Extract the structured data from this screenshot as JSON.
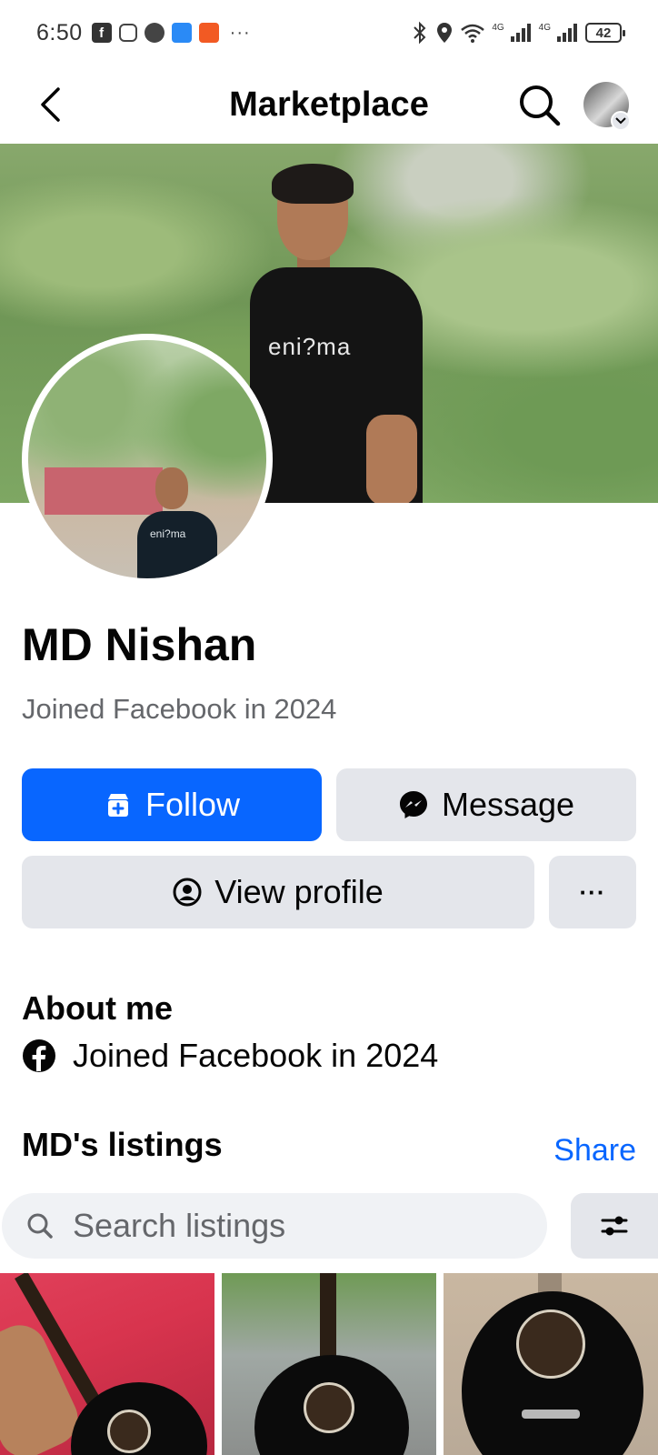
{
  "status_bar": {
    "time": "6:50",
    "more": "···",
    "network_1": "4G",
    "network_2": "4G",
    "battery": "42"
  },
  "header": {
    "title": "Marketplace"
  },
  "cover": {
    "shirt_text": "eni?ma"
  },
  "profile_picture": {
    "shirt_text": "eni?ma"
  },
  "profile": {
    "name": "MD Nishan",
    "joined": "Joined Facebook in 2024"
  },
  "actions": {
    "follow_label": "Follow",
    "message_label": "Message",
    "view_profile_label": "View profile",
    "more_label": "···"
  },
  "about": {
    "title": "About me",
    "joined": "Joined Facebook in 2024"
  },
  "listings": {
    "title": "MD's listings",
    "share_label": "Share",
    "search_placeholder": "Search listings"
  },
  "colors": {
    "primary": "#0866ff",
    "button_gray": "#e4e6eb",
    "secondary_text": "#65676b",
    "text": "#050505"
  },
  "icons": [
    "back-arrow-icon",
    "search-icon",
    "chevron-down-icon",
    "follow-store-icon",
    "messenger-icon",
    "profile-circle-icon",
    "more-icon",
    "facebook-icon",
    "filter-icon"
  ]
}
